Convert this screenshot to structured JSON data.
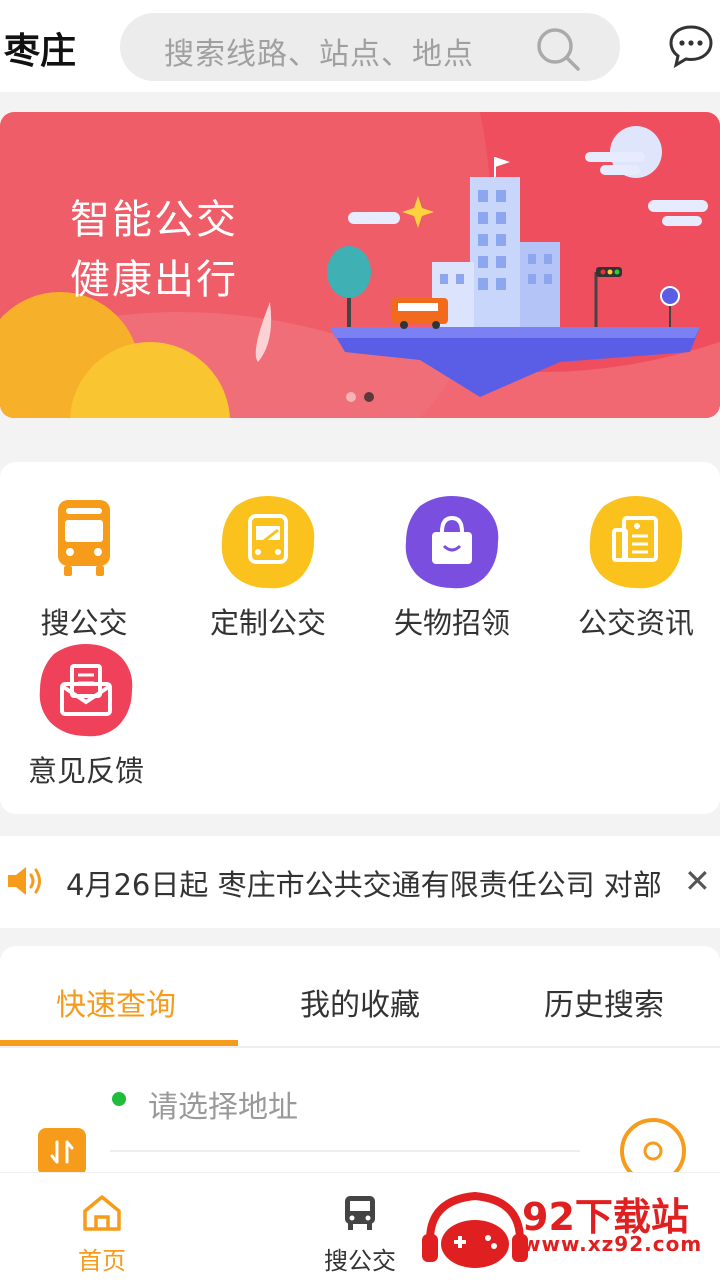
{
  "header": {
    "city": "枣庄",
    "search_placeholder": "搜索线路、站点、地点"
  },
  "banner": {
    "line1": "智能公交",
    "line2": "健康出行",
    "dot_count": 2,
    "active_dot": 2
  },
  "menu": {
    "items": [
      {
        "label": "搜公交",
        "icon": "bus-icon"
      },
      {
        "label": "定制公交",
        "icon": "custom-bus-icon"
      },
      {
        "label": "失物招领",
        "icon": "lost-found-bag-icon"
      },
      {
        "label": "公交资讯",
        "icon": "news-icon"
      },
      {
        "label": "意见反馈",
        "icon": "feedback-mail-icon"
      }
    ]
  },
  "notice": {
    "text": "4月26日起 枣庄市公共交通有限责任公司 对部"
  },
  "tabs": [
    {
      "label": "快速查询"
    },
    {
      "label": "我的收藏"
    },
    {
      "label": "历史搜索"
    }
  ],
  "query": {
    "address_placeholder": "请选择地址"
  },
  "bottom_nav": {
    "home": "首页",
    "search_bus": "搜公交"
  },
  "watermark": {
    "title": "92下载站",
    "url": "www.xz92.com"
  },
  "colors": {
    "accent": "#f79b1b",
    "banner": "#ef5c6a",
    "status_green": "#1fbd3c"
  }
}
